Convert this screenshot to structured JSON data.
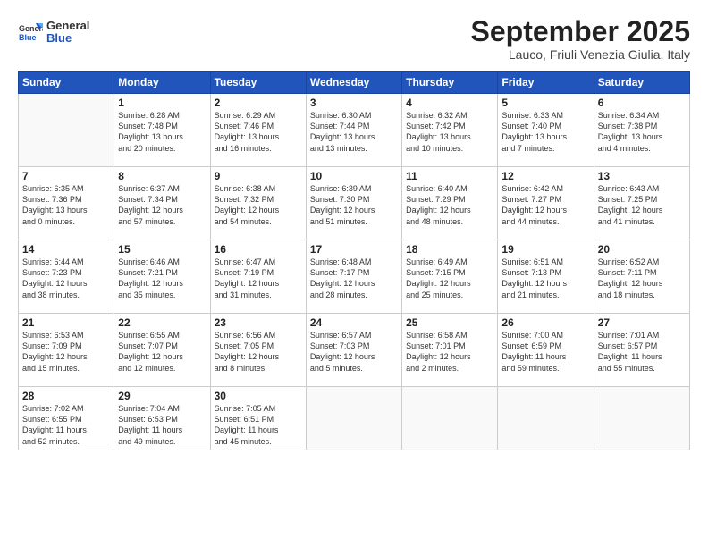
{
  "logo": {
    "general": "General",
    "blue": "Blue"
  },
  "header": {
    "month": "September 2025",
    "location": "Lauco, Friuli Venezia Giulia, Italy"
  },
  "weekdays": [
    "Sunday",
    "Monday",
    "Tuesday",
    "Wednesday",
    "Thursday",
    "Friday",
    "Saturday"
  ],
  "days": [
    {
      "date": "",
      "info": ""
    },
    {
      "date": "1",
      "info": "Sunrise: 6:28 AM\nSunset: 7:48 PM\nDaylight: 13 hours\nand 20 minutes."
    },
    {
      "date": "2",
      "info": "Sunrise: 6:29 AM\nSunset: 7:46 PM\nDaylight: 13 hours\nand 16 minutes."
    },
    {
      "date": "3",
      "info": "Sunrise: 6:30 AM\nSunset: 7:44 PM\nDaylight: 13 hours\nand 13 minutes."
    },
    {
      "date": "4",
      "info": "Sunrise: 6:32 AM\nSunset: 7:42 PM\nDaylight: 13 hours\nand 10 minutes."
    },
    {
      "date": "5",
      "info": "Sunrise: 6:33 AM\nSunset: 7:40 PM\nDaylight: 13 hours\nand 7 minutes."
    },
    {
      "date": "6",
      "info": "Sunrise: 6:34 AM\nSunset: 7:38 PM\nDaylight: 13 hours\nand 4 minutes."
    },
    {
      "date": "7",
      "info": "Sunrise: 6:35 AM\nSunset: 7:36 PM\nDaylight: 13 hours\nand 0 minutes."
    },
    {
      "date": "8",
      "info": "Sunrise: 6:37 AM\nSunset: 7:34 PM\nDaylight: 12 hours\nand 57 minutes."
    },
    {
      "date": "9",
      "info": "Sunrise: 6:38 AM\nSunset: 7:32 PM\nDaylight: 12 hours\nand 54 minutes."
    },
    {
      "date": "10",
      "info": "Sunrise: 6:39 AM\nSunset: 7:30 PM\nDaylight: 12 hours\nand 51 minutes."
    },
    {
      "date": "11",
      "info": "Sunrise: 6:40 AM\nSunset: 7:29 PM\nDaylight: 12 hours\nand 48 minutes."
    },
    {
      "date": "12",
      "info": "Sunrise: 6:42 AM\nSunset: 7:27 PM\nDaylight: 12 hours\nand 44 minutes."
    },
    {
      "date": "13",
      "info": "Sunrise: 6:43 AM\nSunset: 7:25 PM\nDaylight: 12 hours\nand 41 minutes."
    },
    {
      "date": "14",
      "info": "Sunrise: 6:44 AM\nSunset: 7:23 PM\nDaylight: 12 hours\nand 38 minutes."
    },
    {
      "date": "15",
      "info": "Sunrise: 6:46 AM\nSunset: 7:21 PM\nDaylight: 12 hours\nand 35 minutes."
    },
    {
      "date": "16",
      "info": "Sunrise: 6:47 AM\nSunset: 7:19 PM\nDaylight: 12 hours\nand 31 minutes."
    },
    {
      "date": "17",
      "info": "Sunrise: 6:48 AM\nSunset: 7:17 PM\nDaylight: 12 hours\nand 28 minutes."
    },
    {
      "date": "18",
      "info": "Sunrise: 6:49 AM\nSunset: 7:15 PM\nDaylight: 12 hours\nand 25 minutes."
    },
    {
      "date": "19",
      "info": "Sunrise: 6:51 AM\nSunset: 7:13 PM\nDaylight: 12 hours\nand 21 minutes."
    },
    {
      "date": "20",
      "info": "Sunrise: 6:52 AM\nSunset: 7:11 PM\nDaylight: 12 hours\nand 18 minutes."
    },
    {
      "date": "21",
      "info": "Sunrise: 6:53 AM\nSunset: 7:09 PM\nDaylight: 12 hours\nand 15 minutes."
    },
    {
      "date": "22",
      "info": "Sunrise: 6:55 AM\nSunset: 7:07 PM\nDaylight: 12 hours\nand 12 minutes."
    },
    {
      "date": "23",
      "info": "Sunrise: 6:56 AM\nSunset: 7:05 PM\nDaylight: 12 hours\nand 8 minutes."
    },
    {
      "date": "24",
      "info": "Sunrise: 6:57 AM\nSunset: 7:03 PM\nDaylight: 12 hours\nand 5 minutes."
    },
    {
      "date": "25",
      "info": "Sunrise: 6:58 AM\nSunset: 7:01 PM\nDaylight: 12 hours\nand 2 minutes."
    },
    {
      "date": "26",
      "info": "Sunrise: 7:00 AM\nSunset: 6:59 PM\nDaylight: 11 hours\nand 59 minutes."
    },
    {
      "date": "27",
      "info": "Sunrise: 7:01 AM\nSunset: 6:57 PM\nDaylight: 11 hours\nand 55 minutes."
    },
    {
      "date": "28",
      "info": "Sunrise: 7:02 AM\nSunset: 6:55 PM\nDaylight: 11 hours\nand 52 minutes."
    },
    {
      "date": "29",
      "info": "Sunrise: 7:04 AM\nSunset: 6:53 PM\nDaylight: 11 hours\nand 49 minutes."
    },
    {
      "date": "30",
      "info": "Sunrise: 7:05 AM\nSunset: 6:51 PM\nDaylight: 11 hours\nand 45 minutes."
    },
    {
      "date": "",
      "info": ""
    },
    {
      "date": "",
      "info": ""
    },
    {
      "date": "",
      "info": ""
    },
    {
      "date": "",
      "info": ""
    }
  ]
}
